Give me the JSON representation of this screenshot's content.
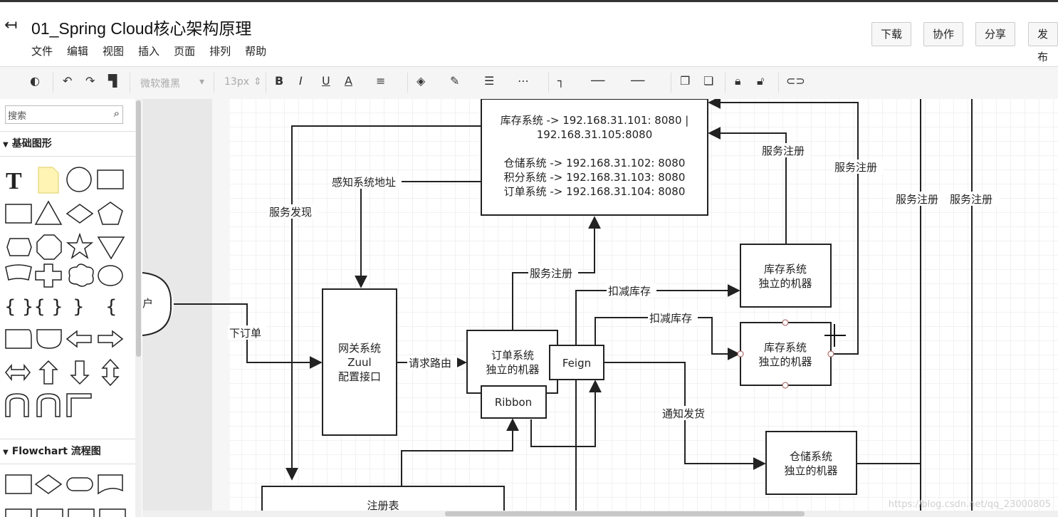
{
  "app": {
    "title": "01_Spring Cloud核心架构原理",
    "menu": [
      "文件",
      "编辑",
      "视图",
      "插入",
      "页面",
      "排列",
      "帮助"
    ],
    "header_buttons": [
      "下载",
      "协作",
      "分享",
      "发布"
    ]
  },
  "toolbar": {
    "font_name": "微软雅黑",
    "font_size": "13px",
    "bold": "B",
    "italic": "I",
    "underline": "U",
    "font_color": "A"
  },
  "sidebar": {
    "search_placeholder": "搜索",
    "section_basic": "基础图形",
    "section_flowchart": "Flowchart 流程图"
  },
  "diagram": {
    "registry_lines": [
      "库存系统 -> 192.168.31.101: 8080 |",
      "192.168.31.105:8080",
      "仓储系统 -> 192.168.31.102: 8080",
      "积分系统 -> 192.168.31.103: 8080",
      "订单系统 -> 192.168.31.104: 8080"
    ],
    "gateway_lines": [
      "网关系统",
      "Zuul",
      "配置接口"
    ],
    "order_lines": [
      "订单系统",
      "独立的机器"
    ],
    "feign": "Feign",
    "ribbon": "Ribbon",
    "inventory1_lines": [
      "库存系统",
      "独立的机器"
    ],
    "inventory2_lines": [
      "库存系统",
      "独立的机器"
    ],
    "warehouse_lines": [
      "仓储系统",
      "独立的机器"
    ],
    "registry_table": "注册表",
    "user_partial": "户",
    "labels": {
      "service_discovery": "服务发现",
      "perceive_address": "感知系统地址",
      "place_order": "下订单",
      "request_routing": "请求路由",
      "service_register": "服务注册",
      "deduct_stock": "扣减库存",
      "notify_shipping": "通知发货"
    }
  },
  "watermark": "https://blog.csdn.net/qq_23000805",
  "colors": {
    "accent": "#333333",
    "canvas_grid": "#e4e4e4",
    "page_gutter": "#e8e8e8"
  }
}
